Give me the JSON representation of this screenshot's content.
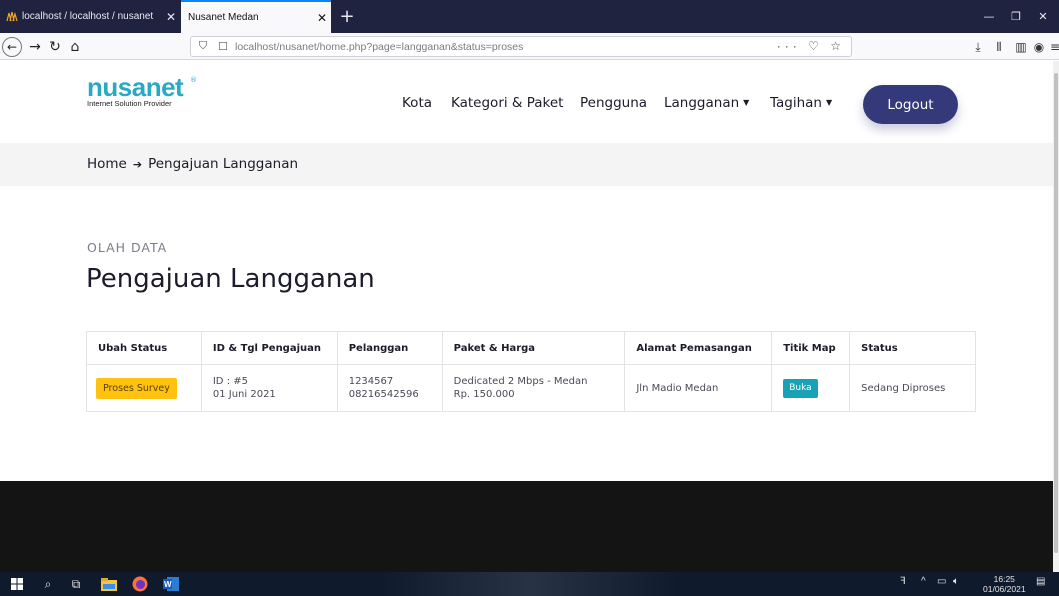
{
  "browser": {
    "tabs": [
      {
        "title": "localhost / localhost / nusanet",
        "active": false
      },
      {
        "title": "Nusanet Medan",
        "active": true
      }
    ],
    "url_host": "localhost",
    "url_path": "/nusanet/home.php?page=langganan&status=proses",
    "url_more": "···"
  },
  "site": {
    "logo_text_a": "nusa",
    "logo_text_b": "net",
    "logo_reg": "®",
    "logo_tagline": "Internet Solution Provider",
    "nav": [
      {
        "label": "Kota"
      },
      {
        "label": "Kategori & Paket"
      },
      {
        "label": "Pengguna"
      },
      {
        "label": "Langganan",
        "dropdown": true
      },
      {
        "label": "Tagihan",
        "dropdown": true
      }
    ],
    "logout_label": "Logout"
  },
  "breadcrumb": {
    "home": "Home",
    "current": "Pengajuan Langganan"
  },
  "page": {
    "overline": "OLAH DATA",
    "title": "Pengajuan Langganan"
  },
  "table": {
    "headers": [
      "Ubah Status",
      "ID & Tgl Pengajuan",
      "Pelanggan",
      "Paket & Harga",
      "Alamat Pemasangan",
      "Titik Map",
      "Status"
    ],
    "rows": [
      {
        "action": "Proses Survey",
        "id": "ID : #5",
        "date": "01 Juni 2021",
        "customer_id": "1234567",
        "customer_phone": "08216542596",
        "package": "Dedicated 2 Mbps - Medan",
        "price": "Rp. 150.000",
        "address": "Jln Madio Medan",
        "map_label": "Buka",
        "status": "Sedang Diproses"
      }
    ]
  },
  "taskbar": {
    "time": "16:25",
    "date": "01/06/2021"
  },
  "colors": {
    "brand": "#2aa9c6",
    "button": "#34397a",
    "badge_warning": "#ffc20e",
    "badge_info": "#17a2b8",
    "footer": "#141414"
  }
}
